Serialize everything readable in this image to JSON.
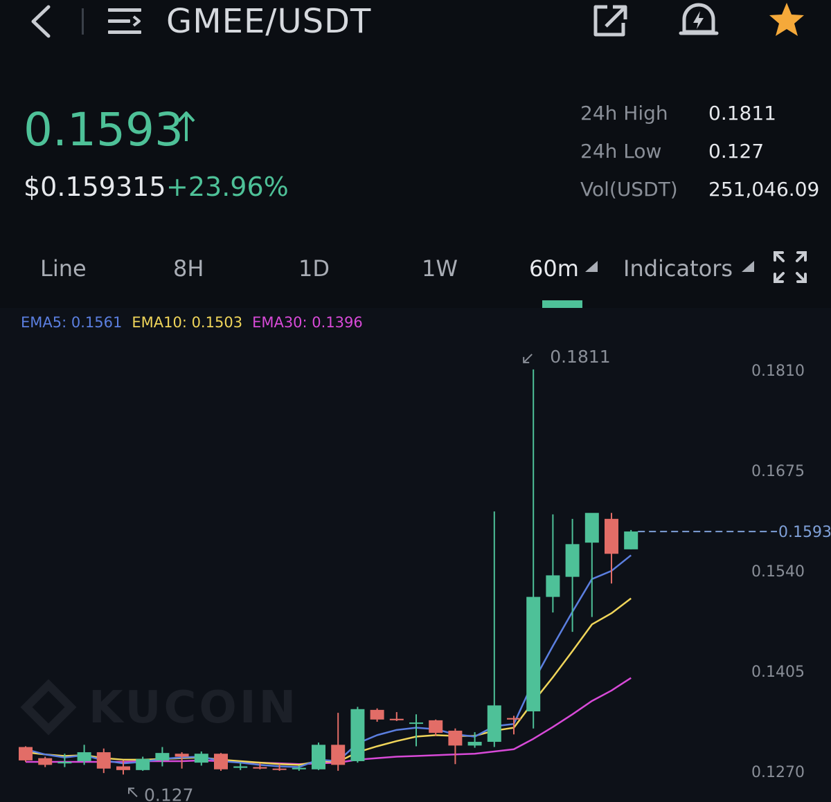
{
  "header": {
    "pair": "GMEE/USDT",
    "icons": [
      "back-icon",
      "menu-icon",
      "share-icon",
      "price-alert-icon",
      "favorite-star-icon"
    ],
    "star_color": "#f5a93a"
  },
  "ticker": {
    "last_price": "0.1593",
    "usd_price": "$0.159315",
    "change_pct": "+23.96%",
    "up_color": "#4ec198",
    "down_color": "#e26d67",
    "stats": [
      {
        "label": "24h High",
        "value": "0.1811"
      },
      {
        "label": "24h Low",
        "value": "0.127"
      },
      {
        "label": "Vol(USDT)",
        "value": "251,046.09"
      }
    ]
  },
  "tabs": {
    "line": "Line",
    "h8": "8H",
    "d1": "1D",
    "w1": "1W",
    "interval": "60m",
    "indicators": "Indicators",
    "active": "60m"
  },
  "ema": {
    "ema5_label": "EMA5: 0.1561",
    "ema10_label": "EMA10: 0.1503",
    "ema30_label": "EMA30: 0.1396",
    "ema5_color": "#5b7fe0",
    "ema10_color": "#f0d55a",
    "ema30_color": "#d84ad8"
  },
  "watermark": "KUCOIN",
  "chart_data": {
    "type": "candlestick",
    "y_ticks": [
      "0.1810",
      "0.1675",
      "0.1540",
      "0.1405",
      "0.1270"
    ],
    "y_tick_values": [
      0.181,
      0.1675,
      0.154,
      0.1405,
      0.127
    ],
    "ylim": [
      0.127,
      0.181
    ],
    "high_marker": "0.1811",
    "low_marker": "0.127",
    "current_price_label": "0.1593",
    "current_price": 0.1593,
    "candles": [
      {
        "o": 0.1303,
        "h": 0.1304,
        "l": 0.1283,
        "c": 0.1285
      },
      {
        "o": 0.1288,
        "h": 0.129,
        "l": 0.1276,
        "c": 0.1279
      },
      {
        "o": 0.1281,
        "h": 0.1294,
        "l": 0.1276,
        "c": 0.1283
      },
      {
        "o": 0.1284,
        "h": 0.1306,
        "l": 0.1279,
        "c": 0.1296
      },
      {
        "o": 0.1296,
        "h": 0.1301,
        "l": 0.1268,
        "c": 0.1274
      },
      {
        "o": 0.1277,
        "h": 0.1285,
        "l": 0.1266,
        "c": 0.1272
      },
      {
        "o": 0.1272,
        "h": 0.129,
        "l": 0.1271,
        "c": 0.1287
      },
      {
        "o": 0.1285,
        "h": 0.1303,
        "l": 0.1277,
        "c": 0.1295
      },
      {
        "o": 0.1294,
        "h": 0.1296,
        "l": 0.1274,
        "c": 0.129
      },
      {
        "o": 0.1282,
        "h": 0.1297,
        "l": 0.1278,
        "c": 0.1294
      },
      {
        "o": 0.1294,
        "h": 0.1295,
        "l": 0.1271,
        "c": 0.1273
      },
      {
        "o": 0.1275,
        "h": 0.1282,
        "l": 0.1272,
        "c": 0.1277
      },
      {
        "o": 0.1276,
        "h": 0.1281,
        "l": 0.1273,
        "c": 0.1274
      },
      {
        "o": 0.1274,
        "h": 0.128,
        "l": 0.1271,
        "c": 0.1273
      },
      {
        "o": 0.1273,
        "h": 0.1278,
        "l": 0.1271,
        "c": 0.1275
      },
      {
        "o": 0.1273,
        "h": 0.1309,
        "l": 0.1272,
        "c": 0.1306
      },
      {
        "o": 0.1306,
        "h": 0.1349,
        "l": 0.1271,
        "c": 0.1279
      },
      {
        "o": 0.1284,
        "h": 0.1357,
        "l": 0.1282,
        "c": 0.1354
      },
      {
        "o": 0.1353,
        "h": 0.1355,
        "l": 0.1337,
        "c": 0.134
      },
      {
        "o": 0.1341,
        "h": 0.135,
        "l": 0.1338,
        "c": 0.1339
      },
      {
        "o": 0.1335,
        "h": 0.1347,
        "l": 0.1304,
        "c": 0.1336
      },
      {
        "o": 0.1339,
        "h": 0.134,
        "l": 0.1318,
        "c": 0.1322
      },
      {
        "o": 0.1325,
        "h": 0.1328,
        "l": 0.128,
        "c": 0.1305
      },
      {
        "o": 0.1305,
        "h": 0.1323,
        "l": 0.1302,
        "c": 0.131
      },
      {
        "o": 0.131,
        "h": 0.162,
        "l": 0.1303,
        "c": 0.1359
      },
      {
        "o": 0.1342,
        "h": 0.1345,
        "l": 0.132,
        "c": 0.134
      },
      {
        "o": 0.1351,
        "h": 0.1811,
        "l": 0.1328,
        "c": 0.1505
      },
      {
        "o": 0.1505,
        "h": 0.1616,
        "l": 0.1484,
        "c": 0.1534
      },
      {
        "o": 0.1532,
        "h": 0.161,
        "l": 0.1458,
        "c": 0.1576
      },
      {
        "o": 0.1578,
        "h": 0.1616,
        "l": 0.1478,
        "c": 0.1618
      },
      {
        "o": 0.161,
        "h": 0.1618,
        "l": 0.1523,
        "c": 0.1563
      },
      {
        "o": 0.1569,
        "h": 0.1595,
        "l": 0.1569,
        "c": 0.1593
      }
    ],
    "ema5": [
      0.13,
      0.1293,
      0.1289,
      0.1292,
      0.1285,
      0.1281,
      0.1283,
      0.1287,
      0.1289,
      0.129,
      0.1284,
      0.1282,
      0.1279,
      0.1277,
      0.1276,
      0.1286,
      0.1284,
      0.1308,
      0.1319,
      0.1326,
      0.1329,
      0.1327,
      0.132,
      0.1317,
      0.1331,
      0.1334,
      0.1391,
      0.1439,
      0.1485,
      0.1529,
      0.154,
      0.1561
    ],
    "ema10": [
      0.1296,
      0.1293,
      0.1291,
      0.1292,
      0.1288,
      0.1286,
      0.1286,
      0.1287,
      0.1288,
      0.1289,
      0.1286,
      0.1284,
      0.1282,
      0.128,
      0.1279,
      0.1284,
      0.1283,
      0.1296,
      0.1304,
      0.1311,
      0.1317,
      0.1319,
      0.1318,
      0.1318,
      0.1325,
      0.1329,
      0.1364,
      0.1397,
      0.1432,
      0.1468,
      0.1483,
      0.1503
    ],
    "ema30": [
      0.1283,
      0.1283,
      0.1283,
      0.1283,
      0.1283,
      0.1283,
      0.1284,
      0.1284,
      0.1284,
      0.1285,
      0.1284,
      0.1283,
      0.1282,
      0.1281,
      0.128,
      0.1281,
      0.1282,
      0.1286,
      0.1288,
      0.129,
      0.1291,
      0.1292,
      0.1293,
      0.1294,
      0.1297,
      0.13,
      0.1314,
      0.133,
      0.1347,
      0.1365,
      0.1379,
      0.1396
    ]
  }
}
